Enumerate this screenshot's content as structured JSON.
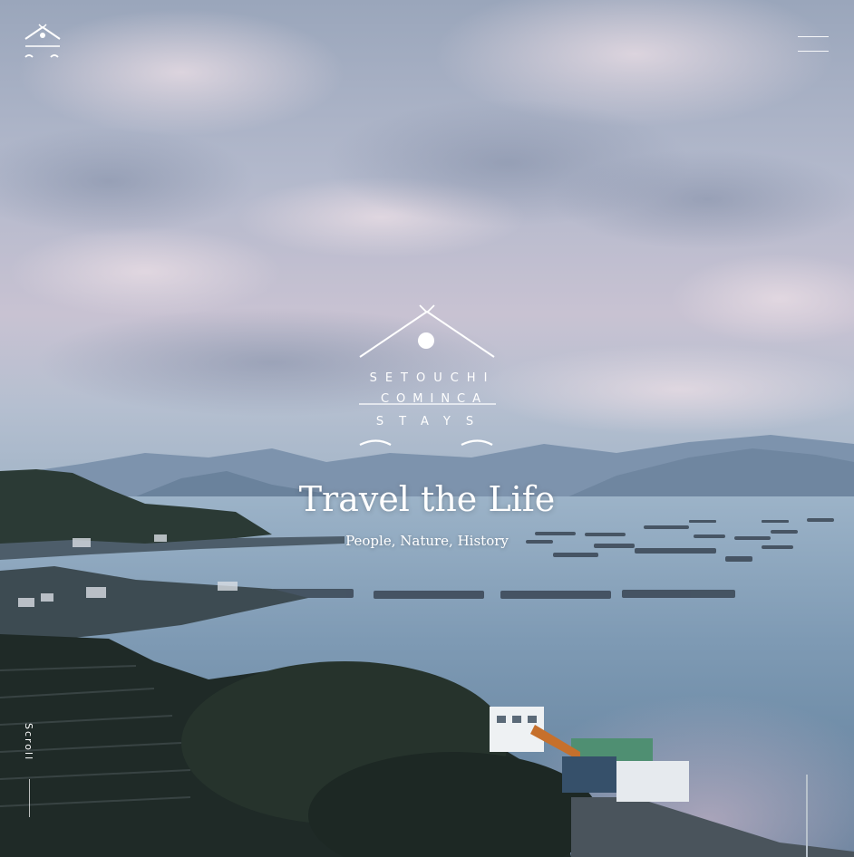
{
  "brand": {
    "line1": "SETOUCHI",
    "line2": "COMINCA",
    "line3": "STAYS"
  },
  "hero": {
    "title": "Travel the Life",
    "subtitle": "People, Nature, History"
  },
  "scroll": {
    "label": "Scroll"
  },
  "icons": {
    "logo": "house-sun-wave-icon",
    "menu": "hamburger-menu-icon",
    "scroll_arrow": "scroll-down-arrow-icon"
  },
  "colors": {
    "text": "#ffffff",
    "sky_top": "#a9b5c8",
    "sea": "#8fa8c0",
    "sunset_pink": "#d9b8c6"
  }
}
